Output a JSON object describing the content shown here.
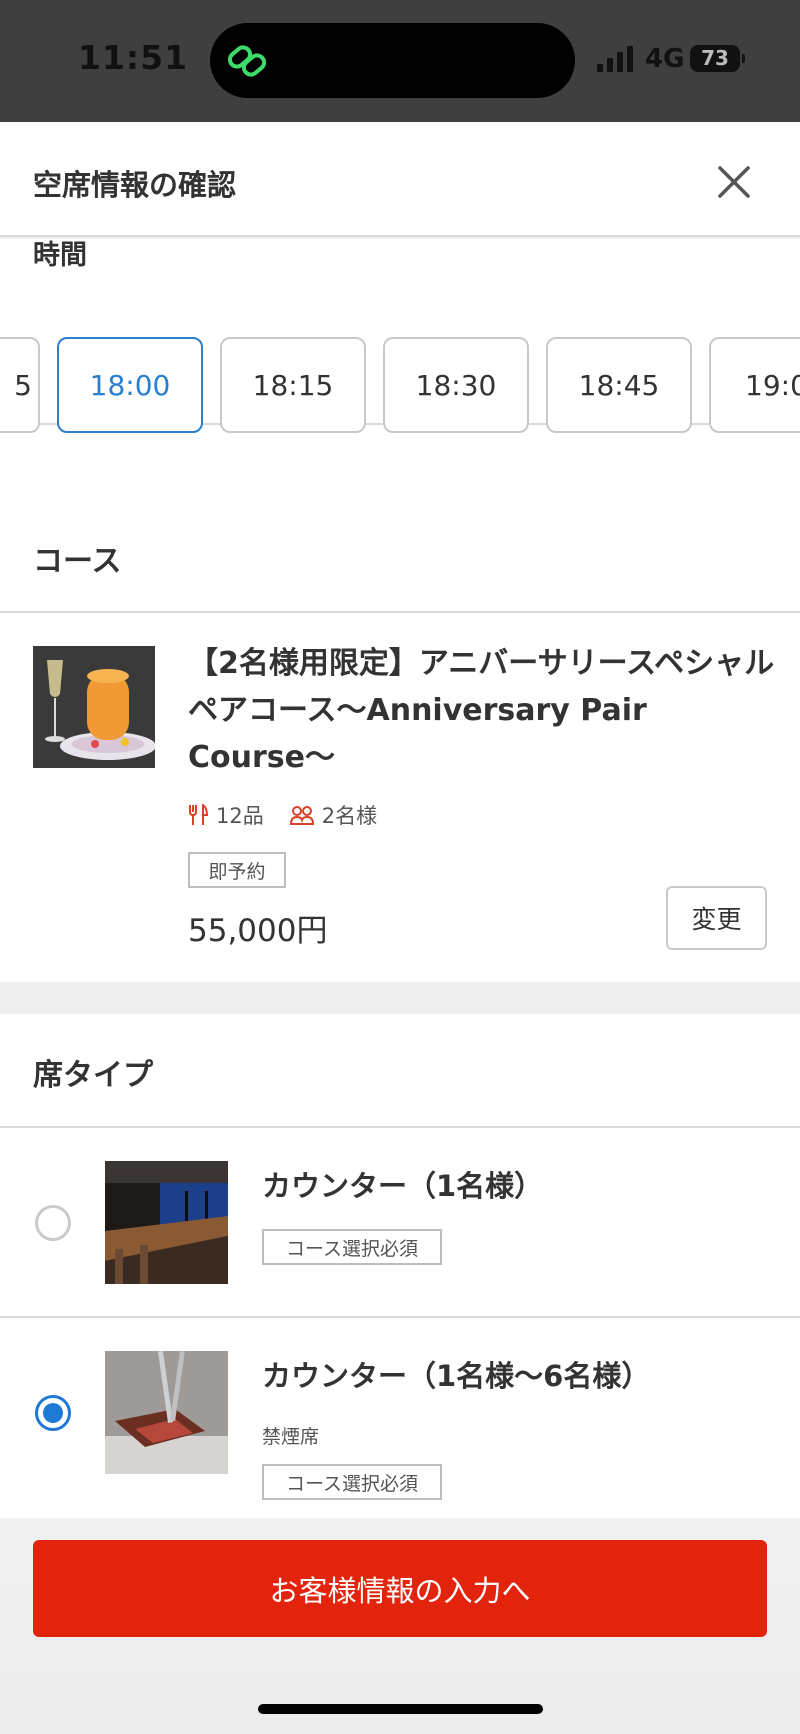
{
  "status_bar": {
    "time": "11:51",
    "network": "4G",
    "battery": "73"
  },
  "header": {
    "title": "空席情報の確認",
    "close_icon": "close-icon"
  },
  "time_section": {
    "label": "時間",
    "slots": [
      "5",
      "18:00",
      "18:15",
      "18:30",
      "18:45",
      "19:0"
    ],
    "selected": "18:00"
  },
  "course_section": {
    "title": "コース",
    "course": {
      "name": "【2名様用限定】アニバーサリースペシャルペアコース〜Anniversary Pair Course〜",
      "items": "12品",
      "people": "2名様",
      "badge": "即予約",
      "price": "55,000円",
      "change_label": "変更"
    }
  },
  "seat_section": {
    "title": "席タイプ",
    "seats": [
      {
        "name": "カウンター（1名様）",
        "note": "",
        "badge": "コース選択必須",
        "selected": false
      },
      {
        "name": "カウンター（1名様〜6名様）",
        "note": "禁煙席",
        "badge": "コース選択必須",
        "selected": true
      }
    ]
  },
  "footer": {
    "cta_label": "お客様情報の入力へ"
  },
  "colors": {
    "accent_blue": "#2a7fd0",
    "cta_red": "#e2240c",
    "icon_red": "#d8402a"
  }
}
